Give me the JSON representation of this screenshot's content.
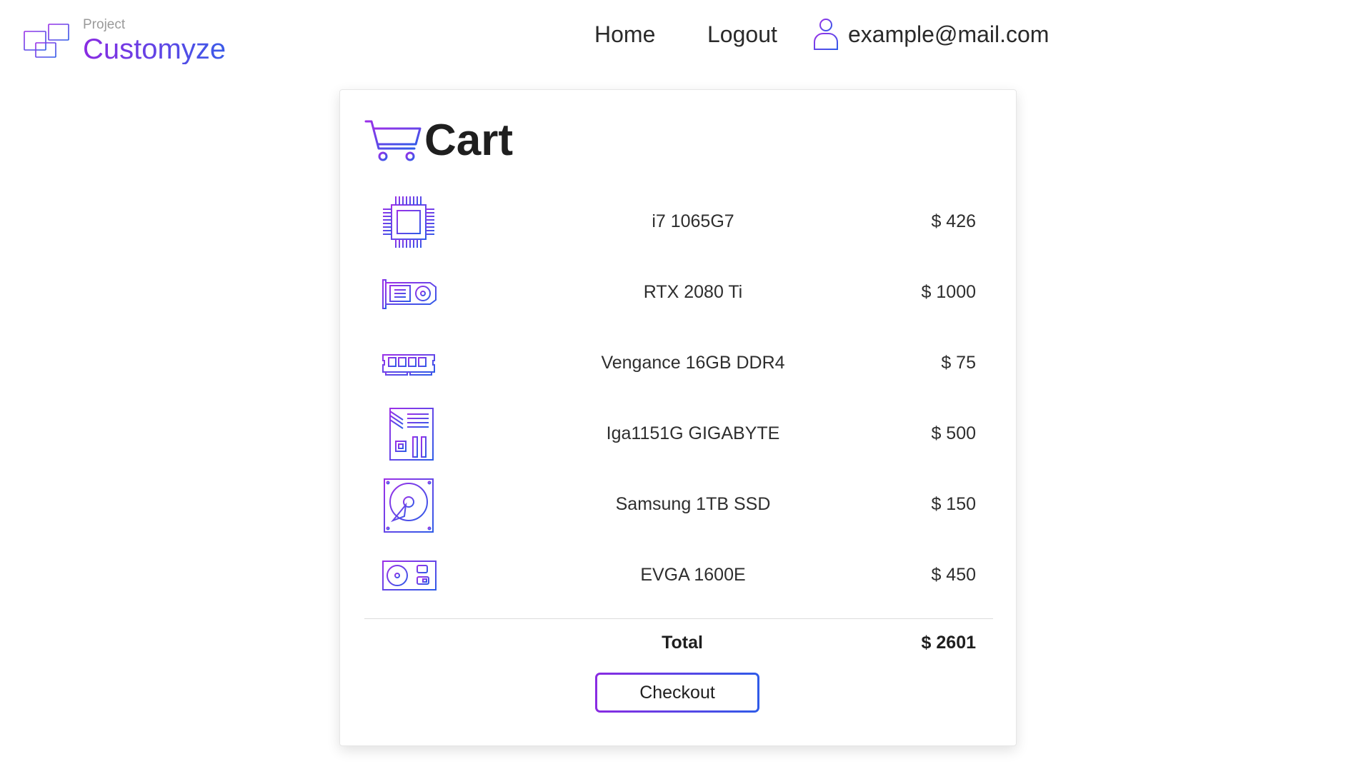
{
  "brand": {
    "small": "Project",
    "name": "Customyze",
    "logo_icon": "monitor-windows-icon"
  },
  "nav": {
    "home": "Home",
    "logout": "Logout",
    "user_icon": "user-icon",
    "email": "example@mail.com"
  },
  "cart": {
    "title": "Cart",
    "icon": "shopping-cart-icon",
    "items": [
      {
        "icon": "cpu-icon",
        "name": "i7 1065G7",
        "price": "$ 426"
      },
      {
        "icon": "gpu-icon",
        "name": "RTX 2080 Ti",
        "price": "$ 1000"
      },
      {
        "icon": "ram-icon",
        "name": "Vengance 16GB DDR4",
        "price": "$ 75"
      },
      {
        "icon": "motherboard-icon",
        "name": "Iga1151G GIGABYTE",
        "price": "$ 500"
      },
      {
        "icon": "hard-drive-icon",
        "name": "Samsung 1TB SSD",
        "price": "$ 150"
      },
      {
        "icon": "power-supply-icon",
        "name": "EVGA 1600E",
        "price": "$ 450"
      }
    ],
    "total_label": "Total",
    "total_value": "$ 2601",
    "checkout_label": "Checkout"
  },
  "colors": {
    "accent_start": "#8a2be2",
    "accent_end": "#2f5be8"
  }
}
